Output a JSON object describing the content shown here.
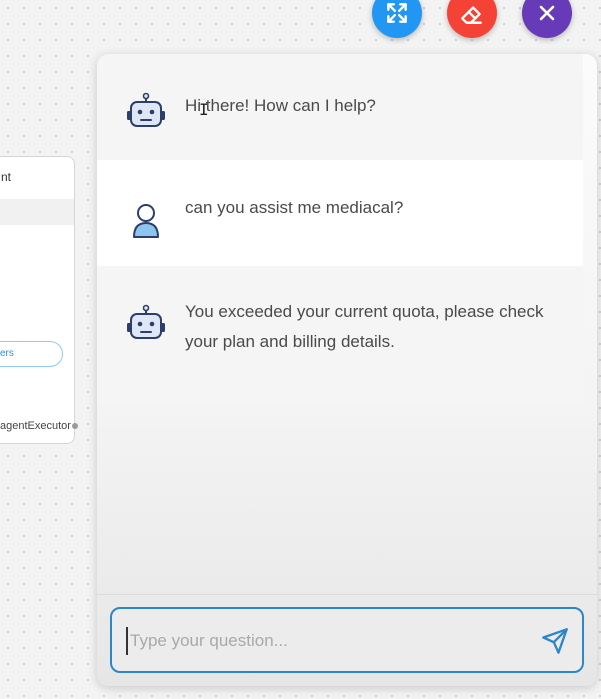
{
  "flow_node": {
    "title_fragment": "nt",
    "pill_label_fragment": "ers",
    "output_label_fragment": "agentExecutor"
  },
  "fab_buttons": {
    "expand": {
      "icon": "expand-icon",
      "color": "#2196f3"
    },
    "clear": {
      "icon": "eraser-icon",
      "color": "#f44336"
    },
    "close": {
      "icon": "close-icon",
      "color": "#673ab7"
    }
  },
  "chat": {
    "messages": [
      {
        "role": "bot",
        "avatar": "robot-icon",
        "text": "Hi there! How can I help?"
      },
      {
        "role": "user",
        "avatar": "user-icon",
        "text": "can you assist me mediacal?"
      },
      {
        "role": "bot",
        "avatar": "robot-icon",
        "text": "You exceeded your current quota, please check your plan and billing details."
      }
    ],
    "input": {
      "value": "",
      "placeholder": "Type your question..."
    },
    "send_icon": "send-icon",
    "accent_color": "#2e86c8"
  }
}
